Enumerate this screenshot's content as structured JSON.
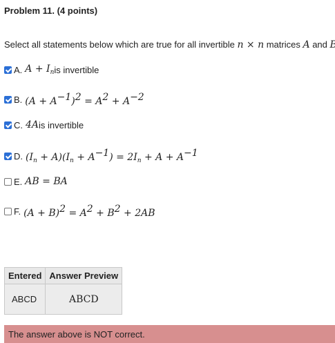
{
  "problem": {
    "number": "Problem 11.",
    "points": "(4 points)"
  },
  "prompt": {
    "text_before": "Select all statements below which are true for all invertible ",
    "math1": "n × n",
    "text_middle": " matrices ",
    "math2": "A",
    "text_and": " and ",
    "math3": "B"
  },
  "options": [
    {
      "label": "A.",
      "checked": true
    },
    {
      "label": "B.",
      "checked": true
    },
    {
      "label": "C.",
      "checked": true
    },
    {
      "label": "D.",
      "checked": true
    },
    {
      "label": "E.",
      "checked": false
    },
    {
      "label": "F.",
      "checked": false
    }
  ],
  "option_text": {
    "a_suffix": " is invertible",
    "c_suffix": " is invertible"
  },
  "results": {
    "headers": [
      "Entered",
      "Answer Preview"
    ],
    "entered": "ABCD",
    "preview": "ABCD"
  },
  "feedback": "The answer above is NOT correct.",
  "colors": {
    "checkbox_checked": "#2b6fd6",
    "feedback_bg": "#d78f8f"
  }
}
